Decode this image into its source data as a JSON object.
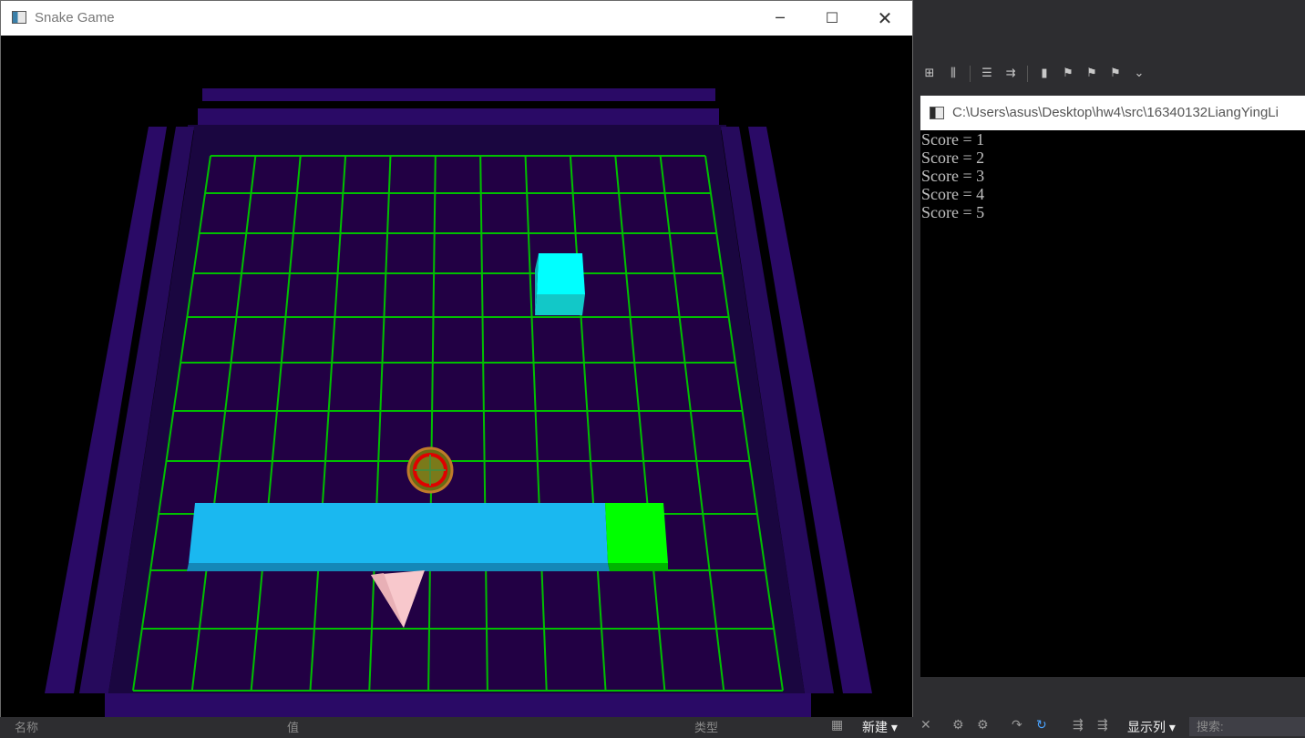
{
  "game": {
    "title": "Snake Game",
    "icon": "app-window-icon",
    "controls": {
      "minimize": "minimize-icon",
      "maximize": "maximize-icon",
      "close": "close-icon"
    },
    "colors": {
      "grid_line": "#00c000",
      "board": "#220044",
      "wall": "#2a0a66",
      "snake_body": "#1ab8f0",
      "snake_head": "#00ff00",
      "food_box": "#00ffff",
      "bonus_ring": "#e00000",
      "pointer": "#f8c8cc"
    }
  },
  "console": {
    "title": "C:\\Users\\asus\\Desktop\\hw4\\src\\16340132LiangYingLi",
    "lines": [
      "Score = 1",
      "Score = 2",
      "Score = 3",
      "Score = 4",
      "Score = 5"
    ]
  },
  "ide_bottom": {
    "col_name": "名称",
    "col_value": "值",
    "col_type": "类型",
    "new_button": "新建",
    "show_columns": "显示列",
    "search_placeholder": "搜索:"
  }
}
